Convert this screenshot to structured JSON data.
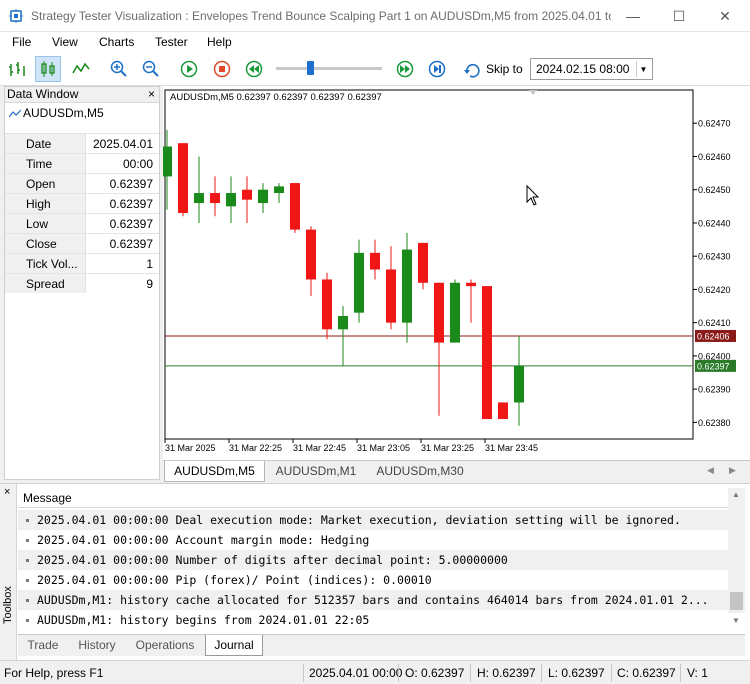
{
  "window": {
    "title": "Strategy Tester Visualization : Envelopes Trend Bounce Scalping Part 1 on AUDUSDm,M5 from 2025.04.01 to 2..."
  },
  "menu": [
    "File",
    "View",
    "Charts",
    "Tester",
    "Help"
  ],
  "toolbar": {
    "skip_label": "Skip to",
    "skip_value": "2024.02.15 08:00",
    "speed_slider_fraction": 0.32
  },
  "data_window": {
    "title": "Data Window",
    "symbol": "AUDUSDm,M5",
    "rows": [
      {
        "key": "Date",
        "value": "2025.04.01"
      },
      {
        "key": "Time",
        "value": "00:00"
      },
      {
        "key": "Open",
        "value": "0.62397"
      },
      {
        "key": "High",
        "value": "0.62397"
      },
      {
        "key": "Low",
        "value": "0.62397"
      },
      {
        "key": "Close",
        "value": "0.62397"
      },
      {
        "key": "Tick Vol...",
        "value": "1"
      },
      {
        "key": "Spread",
        "value": "9"
      }
    ]
  },
  "chart": {
    "header": "AUDUSDm,M5  0.62397 0.62397 0.62397 0.62397",
    "price_labels": [
      "0.62470",
      "0.62460",
      "0.62450",
      "0.62440",
      "0.62430",
      "0.62420",
      "0.62410",
      "0.62400",
      "0.62390",
      "0.62380"
    ],
    "time_labels": [
      "31 Mar 2025",
      "31 Mar 22:25",
      "31 Mar 22:45",
      "31 Mar 23:05",
      "31 Mar 23:25",
      "31 Mar 23:45"
    ],
    "line_red_label": "0.62406",
    "line_green_label": "0.62397",
    "colors": {
      "bull": "#1a8a1a",
      "bear": "#f01616",
      "red_line": "#8b1a1a",
      "green_line": "#2a7a2a"
    }
  },
  "chart_data": {
    "type": "candlestick",
    "ylim": [
      0.62375,
      0.6248
    ],
    "candles": [
      {
        "o": 0.62454,
        "h": 0.62468,
        "l": 0.62444,
        "c": 0.62463
      },
      {
        "o": 0.62464,
        "h": 0.62464,
        "l": 0.62442,
        "c": 0.62443
      },
      {
        "o": 0.62446,
        "h": 0.6246,
        "l": 0.6244,
        "c": 0.62449
      },
      {
        "o": 0.62449,
        "h": 0.62454,
        "l": 0.62442,
        "c": 0.62446
      },
      {
        "o": 0.62445,
        "h": 0.62454,
        "l": 0.6244,
        "c": 0.62449
      },
      {
        "o": 0.6245,
        "h": 0.62454,
        "l": 0.6244,
        "c": 0.62447
      },
      {
        "o": 0.62446,
        "h": 0.62452,
        "l": 0.62443,
        "c": 0.6245
      },
      {
        "o": 0.62449,
        "h": 0.62452,
        "l": 0.62446,
        "c": 0.62451
      },
      {
        "o": 0.62452,
        "h": 0.62452,
        "l": 0.62437,
        "c": 0.62438
      },
      {
        "o": 0.62438,
        "h": 0.62439,
        "l": 0.62418,
        "c": 0.62423
      },
      {
        "o": 0.62423,
        "h": 0.62425,
        "l": 0.62405,
        "c": 0.62408
      },
      {
        "o": 0.62408,
        "h": 0.62415,
        "l": 0.62397,
        "c": 0.62412
      },
      {
        "o": 0.62413,
        "h": 0.62435,
        "l": 0.6241,
        "c": 0.62431
      },
      {
        "o": 0.62431,
        "h": 0.62435,
        "l": 0.62423,
        "c": 0.62426
      },
      {
        "o": 0.62426,
        "h": 0.62433,
        "l": 0.62408,
        "c": 0.6241
      },
      {
        "o": 0.6241,
        "h": 0.62437,
        "l": 0.62404,
        "c": 0.62432
      },
      {
        "o": 0.62434,
        "h": 0.62434,
        "l": 0.6242,
        "c": 0.62422
      },
      {
        "o": 0.62422,
        "h": 0.62422,
        "l": 0.62382,
        "c": 0.62404
      },
      {
        "o": 0.62404,
        "h": 0.62423,
        "l": 0.62404,
        "c": 0.62422
      },
      {
        "o": 0.62422,
        "h": 0.62423,
        "l": 0.6241,
        "c": 0.62421
      },
      {
        "o": 0.62421,
        "h": 0.62421,
        "l": 0.62381,
        "c": 0.62381
      },
      {
        "o": 0.62386,
        "h": 0.62386,
        "l": 0.62381,
        "c": 0.62381
      },
      {
        "o": 0.62386,
        "h": 0.62406,
        "l": 0.62379,
        "c": 0.62397
      }
    ],
    "hlines": [
      0.62406,
      0.62397
    ]
  },
  "chart_tabs": [
    "AUDUSDm,M5",
    "AUDUSDm,M1",
    "AUDUSDm,M30"
  ],
  "toolbox": {
    "side_label": "Toolbox",
    "column_header": "Message",
    "log": [
      "2025.04.01 00:00:00   Deal execution mode: Market execution, deviation setting will be ignored.",
      "2025.04.01 00:00:00   Account margin mode: Hedging",
      "2025.04.01 00:00:00   Number of digits after decimal point: 5.00000000",
      "2025.04.01 00:00:00   Pip (forex)/ Point (indices): 0.00010",
      "AUDUSDm,M1: history cache allocated for 512357 bars and contains 464014 bars from 2024.01.01 2...",
      "AUDUSDm,M1: history begins from 2024.01.01 22:05"
    ],
    "tabs": [
      "Trade",
      "History",
      "Operations",
      "Journal"
    ]
  },
  "status": {
    "help": "For Help, press F1",
    "datetime": "2025.04.01 00:00",
    "open": "O: 0.62397",
    "high": "H: 0.62397",
    "low": "L: 0.62397",
    "close": "C: 0.62397",
    "volume": "V: 1"
  }
}
